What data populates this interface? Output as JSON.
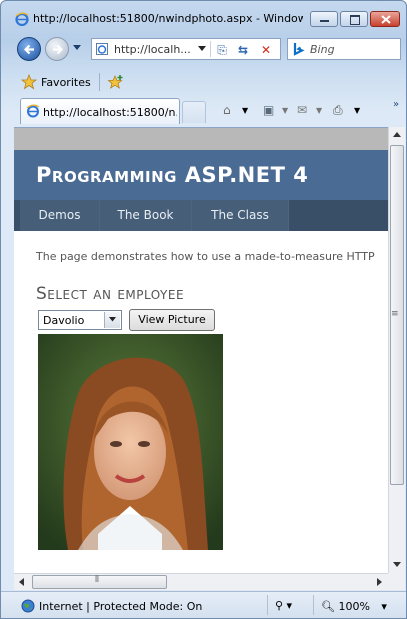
{
  "window": {
    "title": "http://localhost:51800/nwindphoto.aspx - Windows ..."
  },
  "addressbar": {
    "url": "http://localh...",
    "search_placeholder": "Bing"
  },
  "favorites": {
    "label": "Favorites"
  },
  "tabs": [
    {
      "label": "http://localhost:51800/n..."
    }
  ],
  "page": {
    "banner_title": "Programming ASP.NET 4",
    "menu": [
      {
        "label": "Demos"
      },
      {
        "label": "The Book"
      },
      {
        "label": "The Class"
      }
    ],
    "intro": "The page demonstrates how to use a made-to-measure HTTP",
    "heading": "Select an employee",
    "employee_select": {
      "selected": "Davolio"
    },
    "view_button": "View Picture"
  },
  "statusbar": {
    "text": "Internet | Protected Mode: On",
    "zoom": "100%"
  },
  "colors": {
    "banner": "#4a6b93",
    "menubar": "#384f67",
    "frame": "#c4d8ee"
  }
}
